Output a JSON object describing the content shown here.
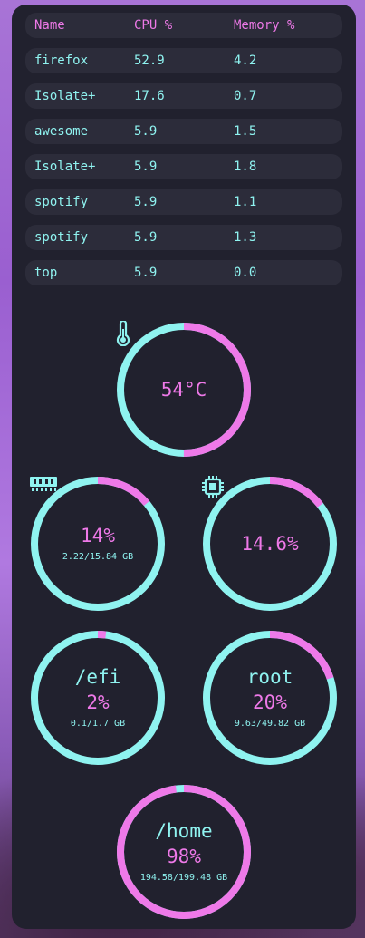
{
  "table": {
    "headers": [
      "Name",
      "CPU %",
      "Memory %"
    ],
    "rows": [
      [
        "firefox",
        "52.9",
        "4.2"
      ],
      [
        "Isolate+",
        "17.6",
        "0.7"
      ],
      [
        "awesome",
        "5.9",
        "1.5"
      ],
      [
        "Isolate+",
        "5.9",
        "1.8"
      ],
      [
        "spotify",
        "5.9",
        "1.1"
      ],
      [
        "spotify",
        "5.9",
        "1.3"
      ],
      [
        "top",
        "5.9",
        "0.0"
      ]
    ]
  },
  "colors": {
    "accent_pink": "#ee79e8",
    "accent_cyan": "#8ff3f0",
    "panel": "#21212e",
    "row": "#2c2c3a"
  },
  "gauges": {
    "temp": {
      "value": "54°C",
      "fraction": 0.5,
      "icon": "thermometer-icon"
    },
    "ram": {
      "value": "14%",
      "detail": "2.22/15.84 GB",
      "fraction": 0.14,
      "icon": "memory-icon"
    },
    "cpu": {
      "value": "14.6%",
      "fraction": 0.146,
      "icon": "cpu-chip-icon"
    },
    "efi": {
      "label": "/efi",
      "value": "2%",
      "detail": "0.1/1.7 GB",
      "fraction": 0.02
    },
    "root": {
      "label": "root",
      "value": "20%",
      "detail": "9.63/49.82 GB",
      "fraction": 0.2
    },
    "home": {
      "label": "/home",
      "value": "98%",
      "detail": "194.58/199.48 GB",
      "fraction": 0.98
    }
  }
}
